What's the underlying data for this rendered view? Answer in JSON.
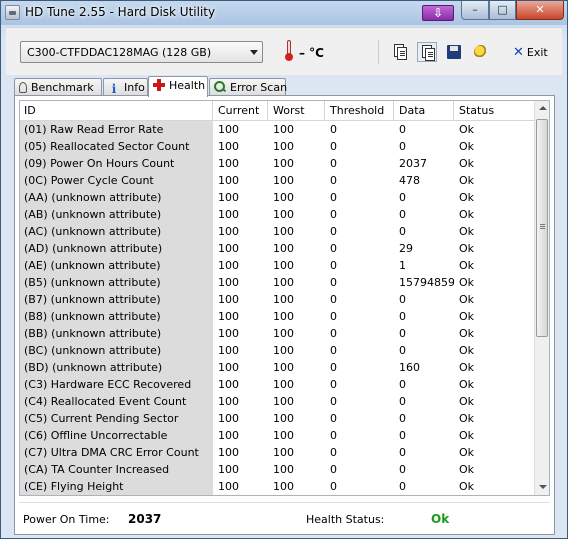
{
  "window": {
    "title": "HD Tune 2.55 - Hard Disk Utility",
    "controls": {
      "minimize": "–",
      "maximize": "□",
      "close": "✕",
      "download": "⇩"
    }
  },
  "toolbar": {
    "drive": "C300-CTFDDAC128MAG (128 GB)",
    "temperature": "– °C",
    "exit_label": "Exit",
    "icons": [
      "copy-text-icon",
      "copy-screenshot-icon",
      "save-icon",
      "options-icon"
    ]
  },
  "tabs": [
    {
      "label": "Benchmark",
      "icon": "benchmark-icon",
      "active": false
    },
    {
      "label": "Info",
      "icon": "info-icon",
      "active": false
    },
    {
      "label": "Health",
      "icon": "health-icon",
      "active": true
    },
    {
      "label": "Error Scan",
      "icon": "scan-icon",
      "active": false
    }
  ],
  "table": {
    "columns": [
      "ID",
      "Current",
      "Worst",
      "Threshold",
      "Data",
      "Status"
    ],
    "rows": [
      [
        "(01) Raw Read Error Rate",
        "100",
        "100",
        "0",
        "0",
        "Ok"
      ],
      [
        "(05) Reallocated Sector Count",
        "100",
        "100",
        "0",
        "0",
        "Ok"
      ],
      [
        "(09) Power On Hours Count",
        "100",
        "100",
        "0",
        "2037",
        "Ok"
      ],
      [
        "(0C) Power Cycle Count",
        "100",
        "100",
        "0",
        "478",
        "Ok"
      ],
      [
        "(AA) (unknown attribute)",
        "100",
        "100",
        "0",
        "0",
        "Ok"
      ],
      [
        "(AB) (unknown attribute)",
        "100",
        "100",
        "0",
        "0",
        "Ok"
      ],
      [
        "(AC) (unknown attribute)",
        "100",
        "100",
        "0",
        "0",
        "Ok"
      ],
      [
        "(AD) (unknown attribute)",
        "100",
        "100",
        "0",
        "29",
        "Ok"
      ],
      [
        "(AE) (unknown attribute)",
        "100",
        "100",
        "0",
        "1",
        "Ok"
      ],
      [
        "(B5) (unknown attribute)",
        "100",
        "100",
        "0",
        "15794859",
        "Ok"
      ],
      [
        "(B7) (unknown attribute)",
        "100",
        "100",
        "0",
        "0",
        "Ok"
      ],
      [
        "(B8) (unknown attribute)",
        "100",
        "100",
        "0",
        "0",
        "Ok"
      ],
      [
        "(BB) (unknown attribute)",
        "100",
        "100",
        "0",
        "0",
        "Ok"
      ],
      [
        "(BC) (unknown attribute)",
        "100",
        "100",
        "0",
        "0",
        "Ok"
      ],
      [
        "(BD) (unknown attribute)",
        "100",
        "100",
        "0",
        "160",
        "Ok"
      ],
      [
        "(C3) Hardware ECC Recovered",
        "100",
        "100",
        "0",
        "0",
        "Ok"
      ],
      [
        "(C4) Reallocated Event Count",
        "100",
        "100",
        "0",
        "0",
        "Ok"
      ],
      [
        "(C5) Current Pending Sector",
        "100",
        "100",
        "0",
        "0",
        "Ok"
      ],
      [
        "(C6) Offline Uncorrectable",
        "100",
        "100",
        "0",
        "0",
        "Ok"
      ],
      [
        "(C7) Ultra DMA CRC Error Count",
        "100",
        "100",
        "0",
        "0",
        "Ok"
      ],
      [
        "(CA) TA Counter Increased",
        "100",
        "100",
        "0",
        "0",
        "Ok"
      ],
      [
        "(CE) Flying Height",
        "100",
        "100",
        "0",
        "0",
        "Ok"
      ]
    ]
  },
  "footer": {
    "power_on_label": "Power On Time:",
    "power_on_value": "2037",
    "health_label": "Health Status:",
    "health_value": "Ok",
    "health_color": "#1a9a1a"
  }
}
